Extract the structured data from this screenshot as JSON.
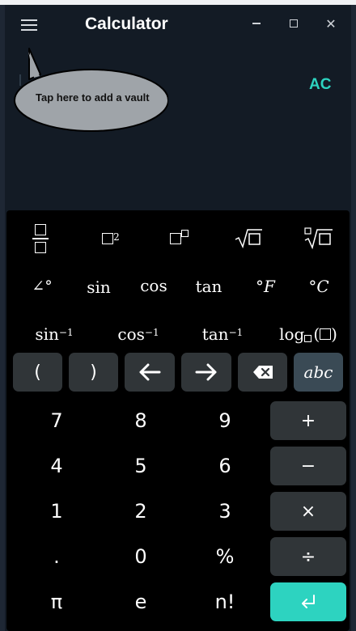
{
  "window": {
    "title": "Calculator",
    "minimize_icon": "minimize-icon",
    "maximize_icon": "maximize-icon",
    "close_icon": "close-icon",
    "close_glyph": "✕"
  },
  "display": {
    "clear_label": "AC",
    "tooltip_text": "Tap here to add a vault",
    "accent_color": "#2dd3c0"
  },
  "functions": {
    "row1": [
      "fraction",
      "square",
      "power",
      "sqrt",
      "nth-root"
    ],
    "angle_label": "∠°",
    "sin": "sin",
    "cos": "cos",
    "tan": "tan",
    "fahrenheit": "°F",
    "celsius": "°C",
    "asin_base": "sin",
    "acos_base": "cos",
    "atan_base": "tan",
    "inverse_exp": "−1",
    "square_exp": "2",
    "log_label": "log",
    "log_paren_open": "(",
    "log_paren_close": ")"
  },
  "controls": {
    "paren_open": "(",
    "paren_close": ")",
    "abc_label": "abc"
  },
  "keys": {
    "digits": [
      "7",
      "8",
      "9",
      "4",
      "5",
      "6",
      "1",
      "2",
      "3",
      ".",
      "0",
      "%",
      "π",
      "e",
      "n!"
    ],
    "ops": [
      "+",
      "−",
      "×",
      "÷"
    ]
  }
}
